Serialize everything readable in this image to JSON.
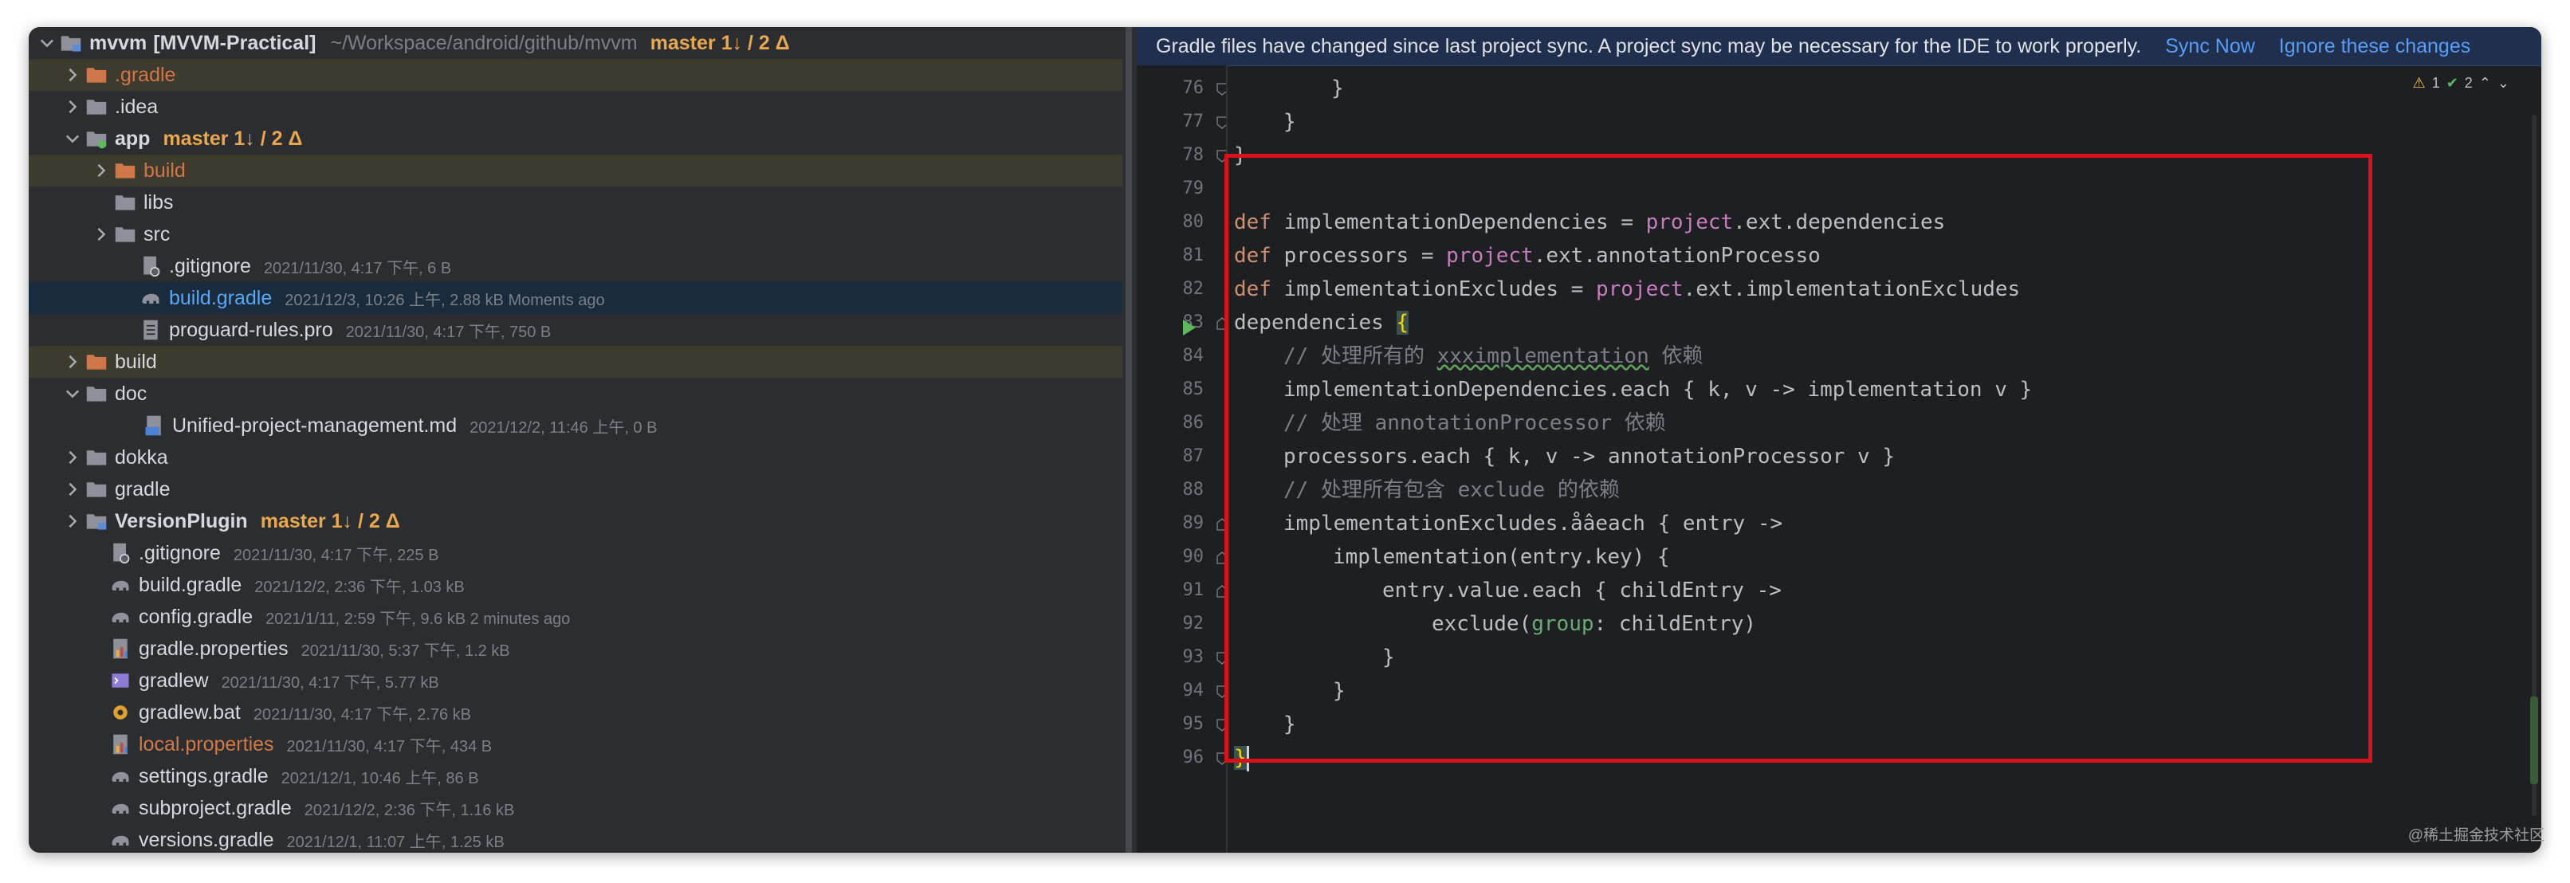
{
  "tree": {
    "root": {
      "label": "mvvm",
      "module": "[MVVM-Practical]",
      "path": "~/Workspace/android/github/mvvm",
      "branch": "master 1↓ / 2 Δ"
    },
    "items": [
      {
        "label": ".gradle",
        "meta": ""
      },
      {
        "label": ".idea",
        "meta": ""
      },
      {
        "label": "app",
        "branch": "master 1↓ / 2 Δ"
      },
      {
        "label": "build",
        "meta": ""
      },
      {
        "label": "libs",
        "meta": ""
      },
      {
        "label": "src",
        "meta": ""
      },
      {
        "label": ".gitignore",
        "meta": "2021/11/30, 4:17 下午, 6 B"
      },
      {
        "label": "build.gradle",
        "meta": "2021/12/3, 10:26 上午, 2.88 kB Moments ago"
      },
      {
        "label": "proguard-rules.pro",
        "meta": "2021/11/30, 4:17 下午, 750 B"
      },
      {
        "label": "build",
        "meta": ""
      },
      {
        "label": "doc",
        "meta": ""
      },
      {
        "label": "Unified-project-management.md",
        "meta": "2021/12/2, 11:46 上午, 0 B"
      },
      {
        "label": "dokka",
        "meta": ""
      },
      {
        "label": "gradle",
        "meta": ""
      },
      {
        "label": "VersionPlugin",
        "branch": "master 1↓ / 2 Δ"
      },
      {
        "label": ".gitignore",
        "meta": "2021/11/30, 4:17 下午, 225 B"
      },
      {
        "label": "build.gradle",
        "meta": "2021/12/2, 2:36 下午, 1.03 kB"
      },
      {
        "label": "config.gradle",
        "meta": "2021/1/11, 2:59 下午, 9.6 kB 2 minutes ago"
      },
      {
        "label": "gradle.properties",
        "meta": "2021/11/30, 5:37 下午, 1.2 kB"
      },
      {
        "label": "gradlew",
        "meta": "2021/11/30, 4:17 下午, 5.77 kB"
      },
      {
        "label": "gradlew.bat",
        "meta": "2021/11/30, 4:17 下午, 2.76 kB"
      },
      {
        "label": "local.properties",
        "meta": "2021/11/30, 4:17 下午, 434 B"
      },
      {
        "label": "settings.gradle",
        "meta": "2021/12/1, 10:46 上午, 86 B"
      },
      {
        "label": "subproject.gradle",
        "meta": "2021/12/2, 2:36 下午, 1.16 kB"
      },
      {
        "label": "versions.gradle",
        "meta": "2021/12/1, 11:07 上午, 1.25 kB"
      }
    ]
  },
  "banner": {
    "message": "Gradle files have changed since last project sync. A project sync may be necessary for the IDE to work properly.",
    "sync_now": "Sync Now",
    "ignore": "Ignore these changes"
  },
  "inspection": {
    "warnings": "1",
    "ok": "2"
  },
  "editor": {
    "line_numbers": [
      "76",
      "77",
      "78",
      "79",
      "80",
      "81",
      "82",
      "83",
      "84",
      "85",
      "86",
      "87",
      "88",
      "89",
      "90",
      "91",
      "92",
      "93",
      "94",
      "95",
      "96"
    ],
    "code": {
      "l76": "}",
      "l77": "}",
      "l78": "}",
      "l80_name": "implementationDependencies",
      "l80_ext": ".ext.dependencies",
      "l81_name": "processors",
      "l81_ext": ".ext.annotationProcesso",
      "l82_name": "implementationExcludes",
      "l82_ext": ".ext.implementationExcludes",
      "kw_def": "def",
      "eq": " = ",
      "kw_project": "project",
      "l83_a": "dependencies ",
      "l83_brace": "{",
      "l84_a": "// 处理所有的 ",
      "l84_b": "xxximplementation",
      "l84_c": " 依赖",
      "l85": "implementationDependencies.each { k, v -> implementation v }",
      "l86": "// 处理 annotationProcessor 依赖",
      "l87": "processors.each { k, v -> annotationProcessor v }",
      "l88": "// 处理所有包含 exclude 的依赖",
      "l89": "implementationExcludes.åâeach { entry ->",
      "l90": "implementation(entry.key) {",
      "l91": "entry.value.each { childEntry ->",
      "l92_a": "exclude(",
      "l92_b": "group",
      "l92_c": ": childEntry)",
      "l93": "}",
      "l94": "}",
      "l95": "}",
      "l96": "}"
    }
  },
  "watermark": "@稀土掘金技术社区",
  "colors": {
    "highlight_box": "#d8111b",
    "branch": "#e9a84f",
    "keyword": "#cf8e6d"
  }
}
